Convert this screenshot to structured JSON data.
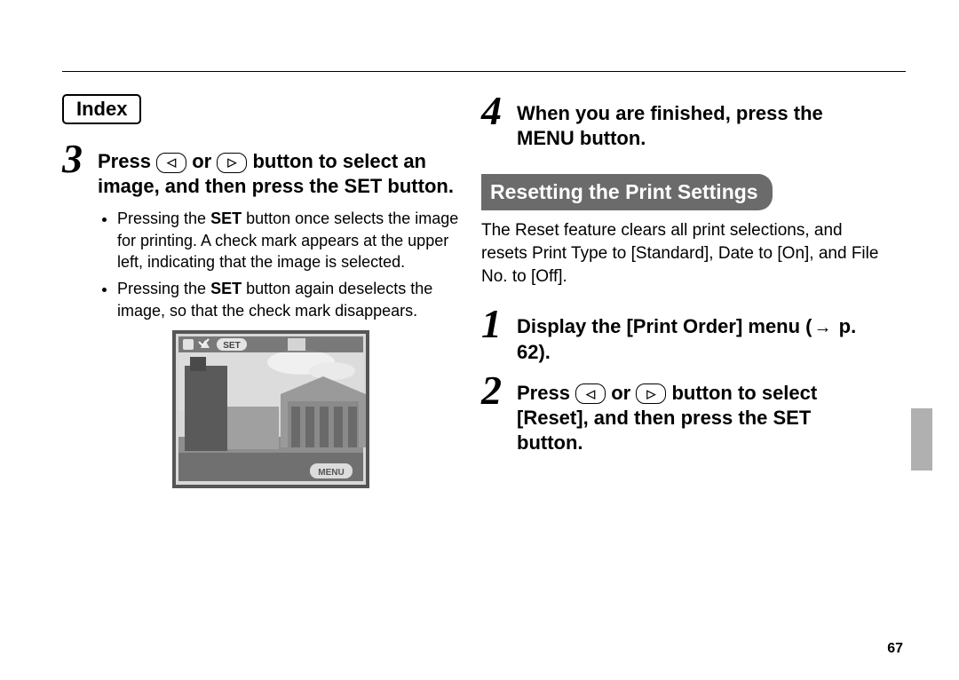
{
  "header": {
    "index_label": "Index"
  },
  "left": {
    "step3": {
      "num": "3",
      "text_prefix": "Press ",
      "text_middle": " or ",
      "text_suffix": " button to select an image, and then press the SET button."
    },
    "bullets": [
      "Pressing the SET button once selects the image for printing. A check mark appears at the upper left, indicating that the image is selected.",
      "Pressing the SET button again deselects the image, so that the check mark disappears."
    ]
  },
  "right": {
    "step4": {
      "num": "4",
      "text": "When you are finished, press the MENU button."
    },
    "section_heading": "Resetting the Print Settings",
    "intro": "The Reset feature clears all print selections, and resets Print Type to [Standard], Date to [On], and File No. to [Off].",
    "step1": {
      "num": "1",
      "text_prefix": "Display the [Print Order] menu (",
      "page_ref": "p. 62",
      "text_suffix": ")."
    },
    "step2": {
      "num": "2",
      "text_prefix": "Press ",
      "text_middle": " or ",
      "text_suffix": " button to select [Reset], and then press the SET button."
    }
  },
  "page_number": "67"
}
